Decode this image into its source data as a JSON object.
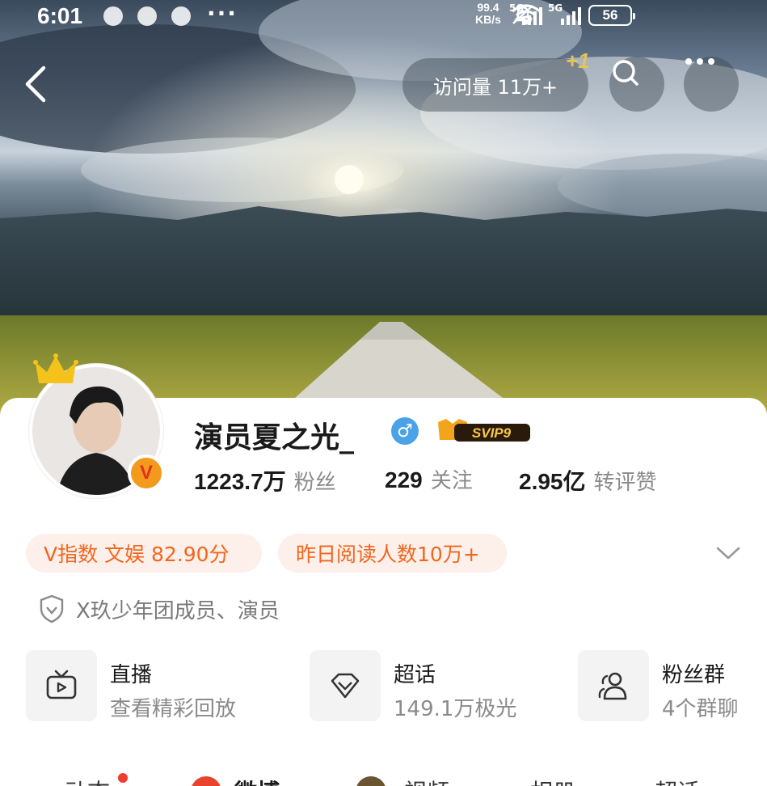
{
  "status_bar": {
    "time": "6:01",
    "more": "···",
    "net_speed_value": "99.4",
    "net_speed_unit": "KB/s",
    "signal_1_label": "5G",
    "signal_2_label": "5G",
    "battery": "56"
  },
  "nav": {
    "visits_label": "访问量 11万+",
    "plus_one": "+1"
  },
  "profile": {
    "username": "演员夏之光_",
    "gender_symbol": "♂",
    "svip_label": "SVIP9",
    "verified_badge": "V",
    "stats": [
      {
        "value": "1223.7万",
        "label": "粉丝"
      },
      {
        "value": "229",
        "label": "关注"
      },
      {
        "value": "2.95亿",
        "label": "转评赞"
      }
    ],
    "pills": {
      "v_index": "V指数 文娱 82.90分",
      "reads": "昨日阅读人数10万+"
    },
    "verification": "X玖少年团成员、演员"
  },
  "features": [
    {
      "title": "直播",
      "subtitle": "查看精彩回放",
      "icon": "tv-icon"
    },
    {
      "title": "超话",
      "subtitle": "149.1万极光",
      "icon": "diamond-icon"
    },
    {
      "title": "粉丝群",
      "subtitle": "4个群聊",
      "icon": "group-icon"
    }
  ],
  "tabs": [
    {
      "label": "动态"
    },
    {
      "label": "微博"
    },
    {
      "label": "视频"
    },
    {
      "label": "相册"
    },
    {
      "label": "超话"
    }
  ],
  "colors": {
    "accent_orange": "#f0661e",
    "pill_bg": "#fdf0ea",
    "gender_blue": "#4aa3e8",
    "tab_dot_red": "#f23b2e"
  }
}
